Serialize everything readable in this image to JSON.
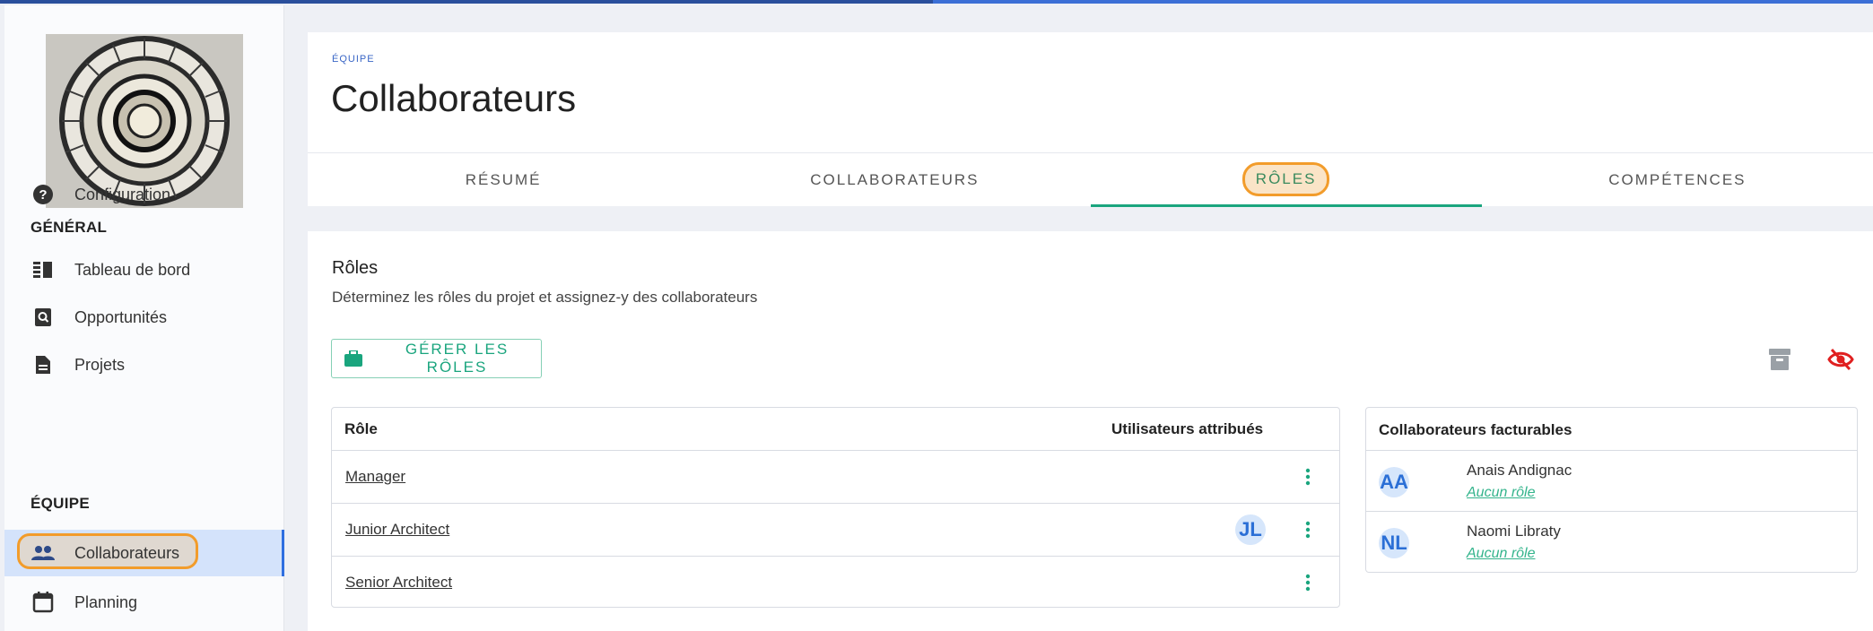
{
  "sidebar": {
    "items": [
      {
        "label": "Configuration",
        "icon": "help-circle-icon"
      },
      {
        "label": "Tableau de bord",
        "icon": "dashboard-icon"
      },
      {
        "label": "Opportunités",
        "icon": "search-doc-icon"
      },
      {
        "label": "Projets",
        "icon": "document-icon"
      },
      {
        "label": "Collaborateurs",
        "icon": "people-icon"
      },
      {
        "label": "Planning",
        "icon": "calendar-icon"
      }
    ],
    "headings": {
      "general": "GÉNÉRAL",
      "team": "ÉQUIPE"
    }
  },
  "header": {
    "eyebrow": "ÉQUIPE",
    "title": "Collaborateurs",
    "tabs": [
      {
        "label": "RÉSUMÉ"
      },
      {
        "label": "COLLABORATEURS"
      },
      {
        "label": "RÔLES"
      },
      {
        "label": "COMPÉTENCES"
      }
    ]
  },
  "roles": {
    "title": "Rôles",
    "description": "Déterminez les rôles du projet et assignez-y des collaborateurs",
    "manage_label": "GÉRER LES RÔLES",
    "table": {
      "col_role": "Rôle",
      "col_users": "Utilisateurs attribués",
      "rows": [
        {
          "name": "Manager",
          "avatar": ""
        },
        {
          "name": "Junior Architect",
          "avatar": "JL"
        },
        {
          "name": "Senior Architect",
          "avatar": ""
        }
      ]
    }
  },
  "billable": {
    "title": "Collaborateurs facturables",
    "rows": [
      {
        "initials": "AA",
        "name": "Anais Andignac",
        "role": "Aucun rôle"
      },
      {
        "initials": "NL",
        "name": "Naomi Libraty",
        "role": "Aucun rôle"
      }
    ]
  },
  "colors": {
    "accent_green": "#1aa57e",
    "primary_blue": "#2f6fe0",
    "highlight_orange": "#f29c2b",
    "hidden_red": "#e02020"
  }
}
